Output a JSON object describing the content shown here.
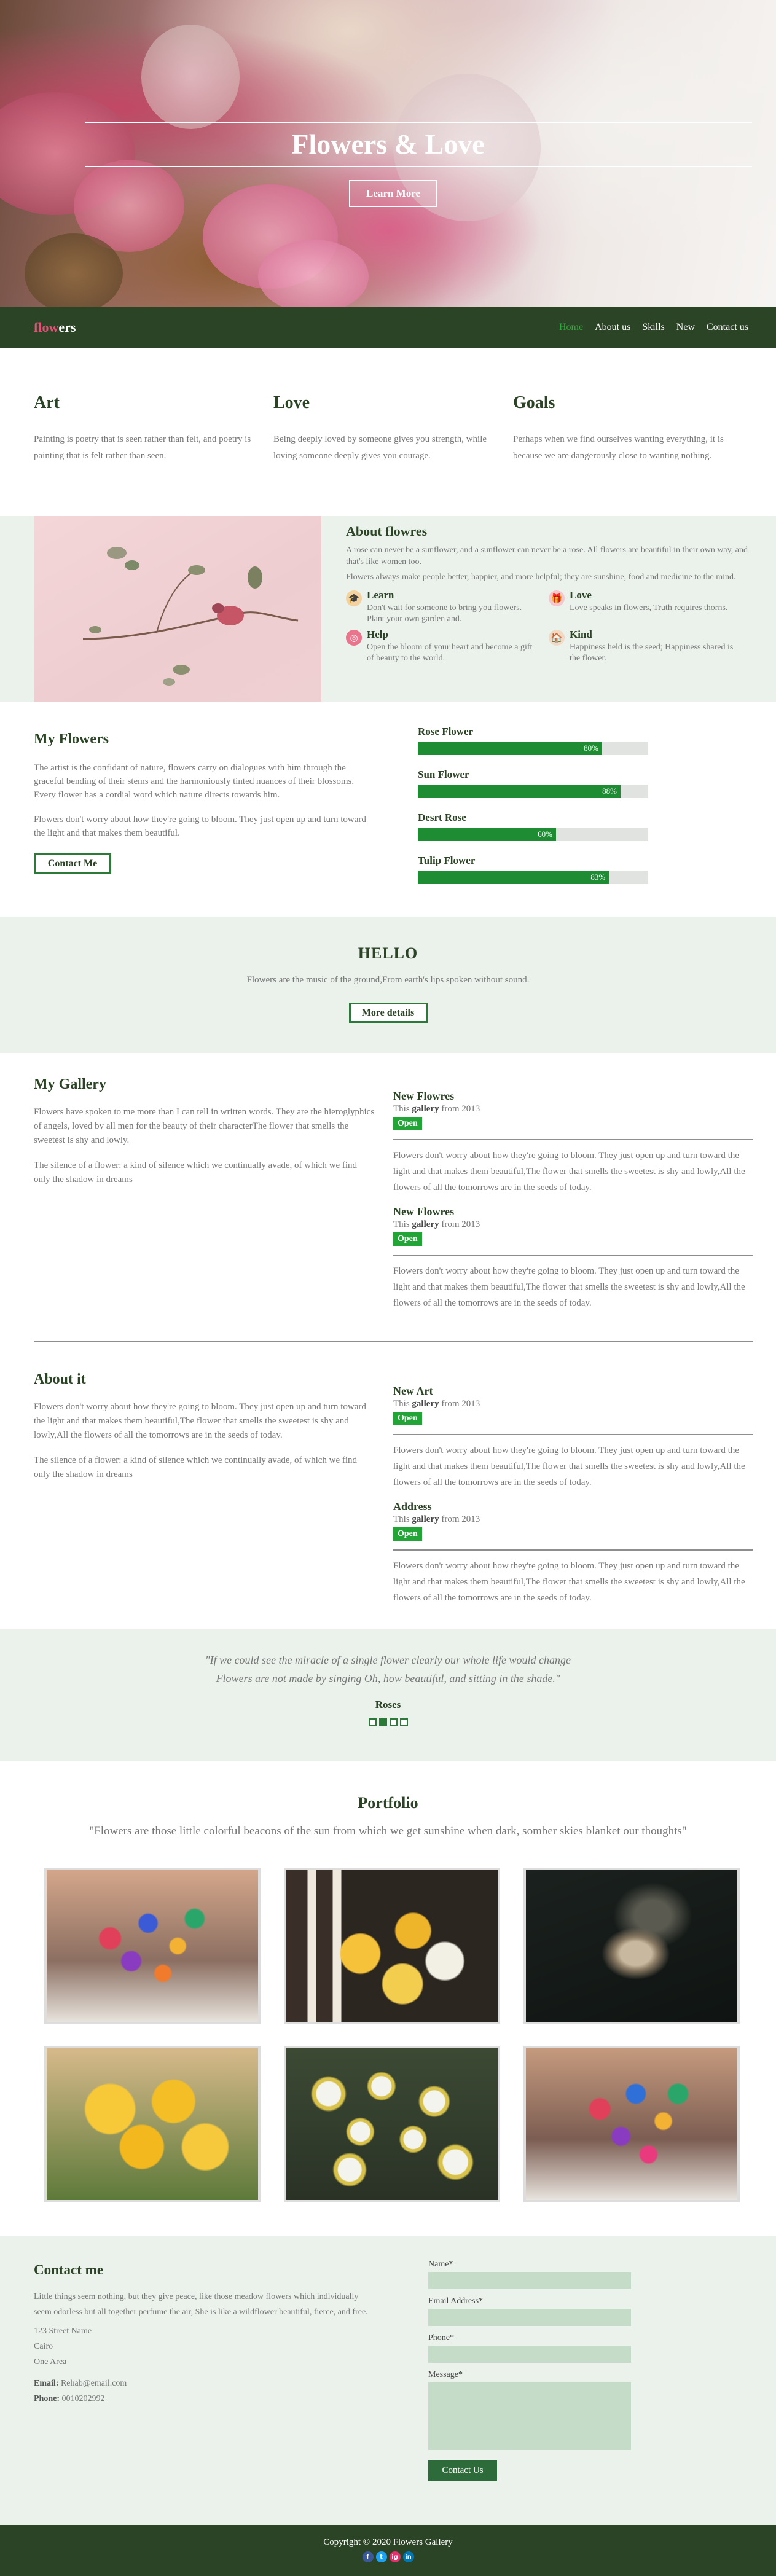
{
  "hero": {
    "title": "Flowers & Love",
    "button": "Learn More"
  },
  "nav": {
    "logo_a": "flow",
    "logo_b": "ers",
    "links": [
      "Home",
      "About us",
      "Skills",
      "New",
      "Contact us"
    ]
  },
  "intro": [
    {
      "title": "Art",
      "text": "Painting is poetry that is seen rather than felt, and poetry is painting that is felt rather than seen."
    },
    {
      "title": "Love",
      "text": "Being deeply loved by someone gives you strength, while loving someone deeply gives you courage."
    },
    {
      "title": "Goals",
      "text": "Perhaps when we find ourselves wanting everything, it is because we are dangerously close to wanting nothing."
    }
  ],
  "about": {
    "title": "About flowres",
    "p1": "A rose can never be a sunflower, and a sunflower can never be a rose. All flowers are beautiful in their own way, and that's like women too.",
    "p2": "Flowers always make people better, happier, and more helpful; they are sunshine, food and medicine to the mind.",
    "features": [
      {
        "title": "Learn",
        "text": "Don't wait for someone to bring you flowers. Plant your own garden and.",
        "icon": "student-icon"
      },
      {
        "title": "Love",
        "text": "Love speaks in flowers, Truth requires thorns.",
        "icon": "gift-icon"
      },
      {
        "title": "Help",
        "text": "Open the bloom of your heart and become a gift of beauty to the world.",
        "icon": "lifebuoy-icon"
      },
      {
        "title": "Kind",
        "text": "Happiness held is the seed; Happiness shared is the flower.",
        "icon": "house-icon"
      }
    ]
  },
  "myflowers": {
    "title": "My Flowers",
    "p1": "The artist is the confidant of nature, flowers carry on dialogues with him through the graceful bending of their stems and the harmoniously tinted nuances of their blossoms. Every flower has a cordial word which nature directs towards him.",
    "p2": "Flowers don't worry about how they're going to bloom. They just open up and turn toward the light and that makes them beautiful.",
    "button": "Contact Me",
    "skills": [
      {
        "name": "Rose Flower",
        "value": 80,
        "label": "80%"
      },
      {
        "name": "Sun Flower",
        "value": 88,
        "label": "88%"
      },
      {
        "name": "Desrt Rose",
        "value": 60,
        "label": "60%"
      },
      {
        "name": "Tulip Flower",
        "value": 83,
        "label": "83%"
      }
    ]
  },
  "hello": {
    "title": "HELLO",
    "text": "Flowers are the music of the ground,From earth's lips spoken without sound.",
    "button": "More details"
  },
  "gallery": {
    "title": "My Gallery",
    "p1": "Flowers have spoken to me more than I can tell in written words. They are the hieroglyphics of angels, loved by all men for the beauty of their characterThe flower that smells the sweetest is shy and lowly.",
    "p2": "The silence of a flower: a kind of silence which we continually avade, of which we find only the shadow in dreams",
    "items": [
      {
        "title": "New Flowres",
        "pre": "This ",
        "bold": "gallery",
        "post": " from 2013",
        "button": "Open",
        "desc": "Flowers don't worry about how they're going to bloom. They just open up and turn toward the light and that makes them beautiful,The flower that smells the sweetest is shy and lowly,All the flowers of all the tomorrows are in the seeds of today."
      },
      {
        "title": "New Flowres",
        "pre": "This ",
        "bold": "gallery",
        "post": " from 2013",
        "button": "Open",
        "desc": "Flowers don't worry about how they're going to bloom. They just open up and turn toward the light and that makes them beautiful,The flower that smells the sweetest is shy and lowly,All the flowers of all the tomorrows are in the seeds of today."
      }
    ]
  },
  "aboutit": {
    "title": "About it",
    "p1": "Flowers don't worry about how they're going to bloom. They just open up and turn toward the light and that makes them beautiful,The flower that smells the sweetest is shy and lowly,All the flowers of all the tomorrows are in the seeds of today.",
    "p2": "The silence of a flower: a kind of silence which we continually avade, of which we find only the shadow in dreams",
    "items": [
      {
        "title": "New Art",
        "pre": "This ",
        "bold": "gallery",
        "post": " from 2013",
        "button": "Open",
        "desc": "Flowers don't worry about how they're going to bloom. They just open up and turn toward the light and that makes them beautiful,The flower that smells the sweetest is shy and lowly,All the flowers of all the tomorrows are in the seeds of today."
      },
      {
        "title": "Address",
        "pre": "This ",
        "bold": "gallery",
        "post": " from 2013",
        "button": "Open",
        "desc": "Flowers don't worry about how they're going to bloom. They just open up and turn toward the light and that makes them beautiful,The flower that smells the sweetest is shy and lowly,All the flowers of all the tomorrows are in the seeds of today."
      }
    ]
  },
  "quote": {
    "line1": "\"If we could see the miracle of a single flower clearly our whole life would change",
    "line2": "Flowers are not made by singing Oh, how beautiful, and sitting in the shade.\"",
    "author": "Roses"
  },
  "portfolio": {
    "title": "Portfolio",
    "subtitle": "\"Flowers are those little colorful beacons of the sun from which we get sunshine when dark, somber skies blanket our thoughts\""
  },
  "contact": {
    "title": "Contact me",
    "text": "Little things seem nothing, but they give peace, like those meadow flowers which individually seem odorless but all together perfume the air, She is like a wildflower beautiful, fierce, and free.",
    "street": "123 Street Name",
    "city": "Cairo",
    "area": "One Area",
    "email_label": "Email:",
    "email": "Rehab@email.com",
    "phone_label": "Phone:",
    "phone": "0010202992",
    "form": {
      "name": "Name*",
      "email": "Email Address*",
      "phone": "Phone*",
      "message": "Message*",
      "button": "Contact Us"
    }
  },
  "footer": {
    "copyright": "Copyright © 2020 Flowers Gallery",
    "socials": [
      "f",
      "t",
      "ig",
      "in"
    ]
  }
}
